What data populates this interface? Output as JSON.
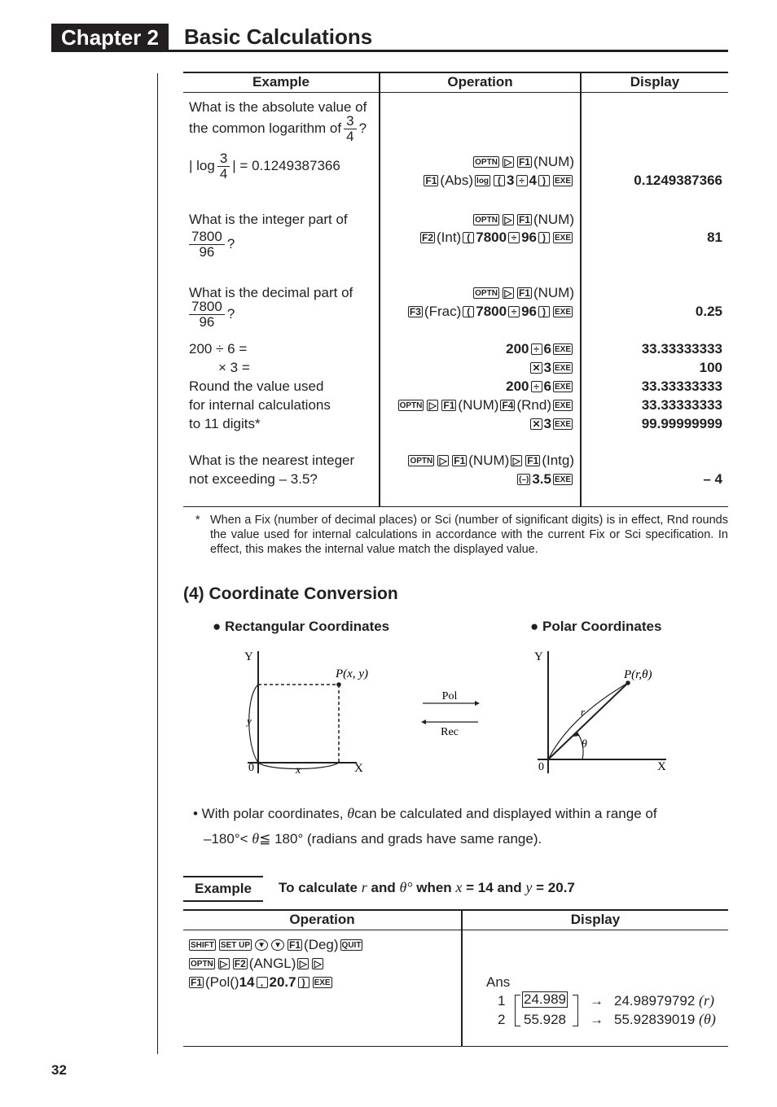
{
  "header": {
    "chapter_label": "Chapter 2",
    "chapter_title": "Basic Calculations"
  },
  "table1": {
    "headers": [
      "Example",
      "Operation",
      "Display"
    ],
    "row1": {
      "example_line1": "What is the absolute value of",
      "example_line2": "the common logarithm of",
      "frac_num": "3",
      "frac_den": "4",
      "qmark": "?",
      "formula_prefix": "| log",
      "formula_suffix": "| = 0.1249387366",
      "op1_keys": [
        "OPTN",
        "▷",
        "F1"
      ],
      "op1_label": "(NUM)",
      "op2_key1": "F1",
      "op2_label": "(Abs)",
      "op2_key2": "log",
      "op2_key3": "(",
      "op2_n1": "3",
      "op2_key4": "÷",
      "op2_n2": "4",
      "op2_key5": ")",
      "op2_key6": "EXE",
      "display": "0.1249387366"
    },
    "row2": {
      "example_line1": "What is the integer part of",
      "frac_num": "7800",
      "frac_den": "96",
      "qmark": "?",
      "op1_keys": [
        "OPTN",
        "▷",
        "F1"
      ],
      "op1_label": "(NUM)",
      "op2_key1": "F2",
      "op2_label": "(Int)",
      "op2_n1": "7800",
      "op2_n2": "96",
      "display": "81"
    },
    "row3": {
      "example_line1": "What is the decimal part of",
      "frac_num": "7800",
      "frac_den": "96",
      "qmark": "?",
      "op1_keys": [
        "OPTN",
        "▷",
        "F1"
      ],
      "op1_label": "(NUM)",
      "op2_key1": "F3",
      "op2_label": "(Frac)",
      "op2_n1": "7800",
      "op2_n2": "96",
      "display": "0.25"
    },
    "row4": {
      "example_lines": [
        "200 ÷ 6 =",
        "× 3 =",
        "Round the value used",
        "for internal calculations",
        "to 11 digits*"
      ],
      "ops": {
        "n200": "200",
        "n6": "6",
        "n3": "3",
        "num_label": "(NUM)",
        "rnd_key": "F4",
        "rnd_label": "(Rnd)"
      },
      "displays": [
        "33.33333333",
        "100",
        "33.33333333",
        "33.33333333",
        "99.99999999"
      ]
    },
    "row5": {
      "example_lines": [
        "What is the nearest integer",
        "not exceeding – 3.5?"
      ],
      "op1_label1": "(NUM)",
      "op1_label2": "(Intg)",
      "op2_neg_key": "(–)",
      "op2_n": "3.5",
      "display": "– 4"
    }
  },
  "footnote": {
    "star": "*",
    "text": "When a Fix (number of decimal places) or Sci (number of significant digits) is in effect, Rnd rounds the value used for internal calculations in accordance with the current Fix or Sci specification. In effect, this makes the internal value match the displayed value."
  },
  "section": {
    "title": "(4) Coordinate Conversion",
    "rect_heading": "● Rectangular Coordinates",
    "polar_heading": "● Polar Coordinates",
    "rect_diagram": {
      "y_axis": "Y",
      "x_axis": "X",
      "origin": "0",
      "point": "P(x, y)",
      "x_label": "x",
      "y_label": "y"
    },
    "arrows": {
      "pol": "Pol",
      "rec": "Rec"
    },
    "polar_diagram": {
      "y_axis": "Y",
      "x_axis": "X",
      "origin": "0",
      "point": "P(r,θ)",
      "r_label": "r",
      "theta_label": "θ"
    },
    "note_line1_a": "• With polar coordinates,",
    "note_theta": "θ",
    "note_line1_b": "can be calculated and displayed within a range of",
    "note_line2_a": "–180°<",
    "note_line2_b": "≦ 180° (radians and grads have same range)."
  },
  "example2": {
    "label": "Example",
    "desc_a": "To calculate",
    "desc_r": "r",
    "desc_b": "and",
    "desc_theta": "θ°",
    "desc_c": "when",
    "desc_x": "x",
    "desc_d": "= 14 and",
    "desc_y": "y",
    "desc_e": "= 20.7",
    "headers": [
      "Operation",
      "Display"
    ],
    "op_line1": {
      "keys": [
        "SHIFT",
        "SET UP",
        "▼",
        "▼",
        "F1"
      ],
      "label": "(Deg)",
      "key_end": "QUIT"
    },
    "op_line2": {
      "keys": [
        "OPTN",
        "▷",
        "F2"
      ],
      "label": "(ANGL)",
      "keys2": [
        "▷",
        "▷"
      ]
    },
    "op_line3": {
      "key": "F1",
      "label": "(Pol()",
      "n1": "14",
      "comma": ",",
      "n2": "20.7",
      "close": ")",
      "exe": "EXE"
    },
    "display": {
      "ans": "Ans",
      "rows": [
        {
          "idx": "1",
          "value": "24.989",
          "arrow": "→",
          "full": "24.98979792",
          "unit": "(r)"
        },
        {
          "idx": "2",
          "value": "55.928",
          "arrow": "→",
          "full": "55.92839019",
          "unit": "(θ)"
        }
      ]
    }
  },
  "page_number": "32"
}
